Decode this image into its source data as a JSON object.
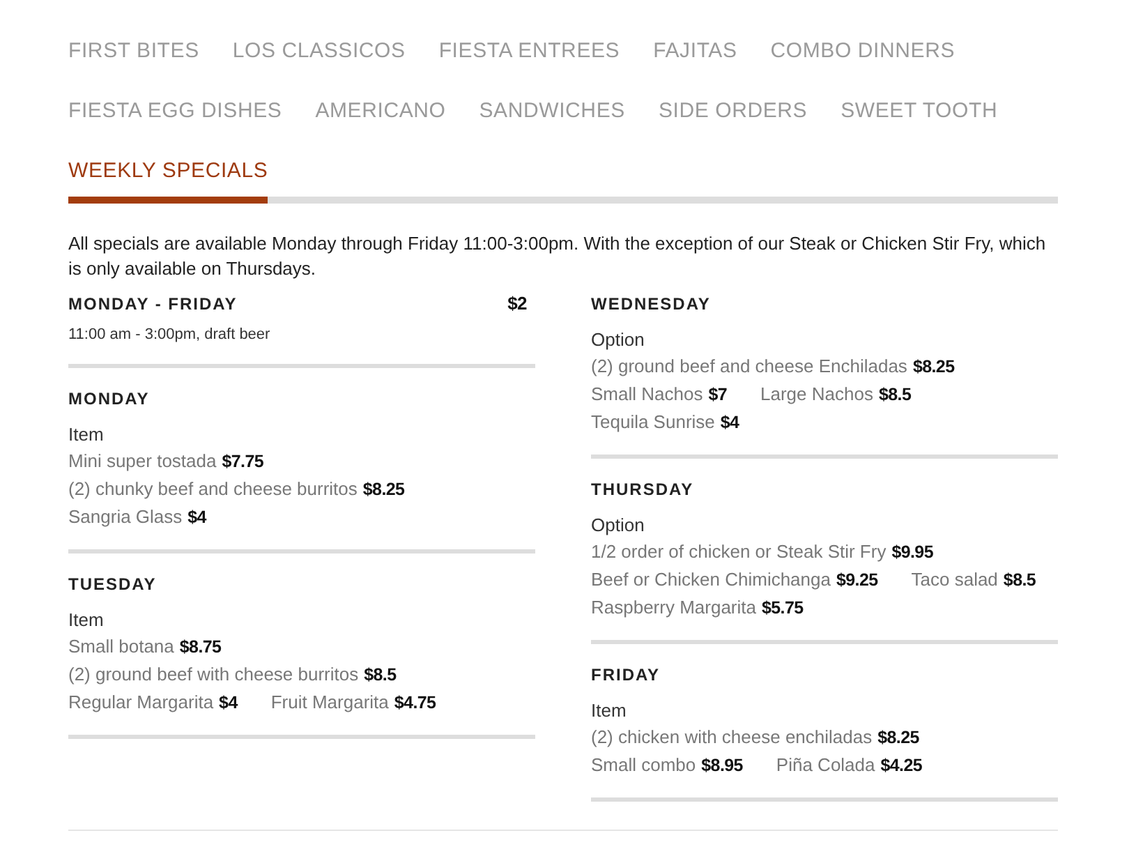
{
  "tab_rows": [
    [
      {
        "label": "FIRST BITES",
        "selected": false
      },
      {
        "label": "LOS CLASSICOS",
        "selected": false
      },
      {
        "label": "FIESTA ENTREES",
        "selected": false
      },
      {
        "label": "FAJITAS",
        "selected": false
      },
      {
        "label": "COMBO DINNERS",
        "selected": false
      }
    ],
    [
      {
        "label": "FIESTA EGG DISHES",
        "selected": false
      },
      {
        "label": "AMERICANO",
        "selected": false
      },
      {
        "label": "SANDWICHES",
        "selected": false
      },
      {
        "label": "SIDE ORDERS",
        "selected": false
      },
      {
        "label": "SWEET TOOTH",
        "selected": false
      }
    ],
    [
      {
        "label": "WEEKLY SPECIALS",
        "selected": true
      }
    ]
  ],
  "intro": "All specials are available Monday through Friday 11:00-3:00pm. With the exception of our Steak or Chicken Stir Fry, which is only available on Thursdays.",
  "columns": [
    [
      {
        "kind": "summary",
        "title": "MONDAY - FRIDAY",
        "price": "$2",
        "note": "11:00 am - 3:00pm, draft beer"
      },
      {
        "kind": "daily",
        "title": "MONDAY",
        "label": "Item",
        "lines": [
          [
            {
              "name": "Mini super tostada",
              "price": "$7.75"
            }
          ],
          [
            {
              "name": "(2) chunky beef and cheese burritos",
              "price": "$8.25"
            }
          ],
          [
            {
              "name": "Sangria Glass",
              "price": "$4"
            }
          ]
        ]
      },
      {
        "kind": "daily",
        "title": "TUESDAY",
        "label": "Item",
        "lines": [
          [
            {
              "name": "Small botana",
              "price": "$8.75"
            }
          ],
          [
            {
              "name": "(2) ground beef with cheese burritos",
              "price": "$8.5"
            }
          ],
          [
            {
              "name": "Regular Margarita",
              "price": "$4"
            },
            {
              "name": "Fruit Margarita",
              "price": "$4.75"
            }
          ]
        ]
      }
    ],
    [
      {
        "kind": "daily",
        "title": "WEDNESDAY",
        "label": "Option",
        "lines": [
          [
            {
              "name": "(2) ground beef and cheese Enchiladas",
              "price": "$8.25"
            }
          ],
          [
            {
              "name": "Small Nachos",
              "price": "$7"
            },
            {
              "name": "Large Nachos",
              "price": "$8.5"
            }
          ],
          [
            {
              "name": "Tequila Sunrise",
              "price": "$4"
            }
          ]
        ]
      },
      {
        "kind": "daily",
        "title": "THURSDAY",
        "label": "Option",
        "lines": [
          [
            {
              "name": "1/2 order of chicken or Steak Stir Fry",
              "price": "$9.95"
            }
          ],
          [
            {
              "name": "Beef or Chicken Chimichanga",
              "price": "$9.25"
            },
            {
              "name": "Taco salad",
              "price": "$8.5"
            }
          ],
          [
            {
              "name": "Raspberry Margarita",
              "price": "$5.75"
            }
          ]
        ]
      },
      {
        "kind": "daily",
        "title": "FRIDAY",
        "label": "Item",
        "lines": [
          [
            {
              "name": "(2) chicken with cheese enchiladas",
              "price": "$8.25"
            }
          ],
          [
            {
              "name": "Small combo",
              "price": "$8.95"
            },
            {
              "name": "Piña Colada",
              "price": "$4.25"
            }
          ]
        ]
      }
    ]
  ]
}
